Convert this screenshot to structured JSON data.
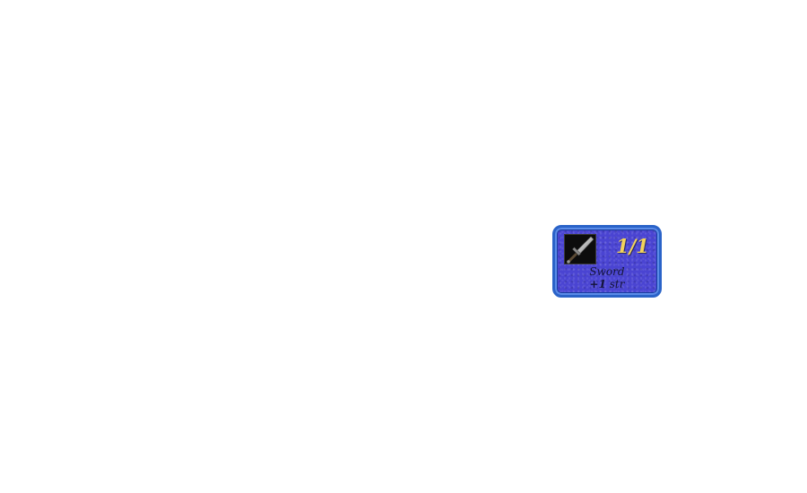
{
  "inventory_item": {
    "icon": "sword-icon",
    "count": "1/1",
    "name": "Sword",
    "bonus_value": "+1",
    "bonus_stat": "str",
    "colors": {
      "card_fill": "#4a44d2",
      "card_border": "#2a63c8",
      "count_text": "#f2d35a",
      "label_text": "#141438"
    }
  }
}
